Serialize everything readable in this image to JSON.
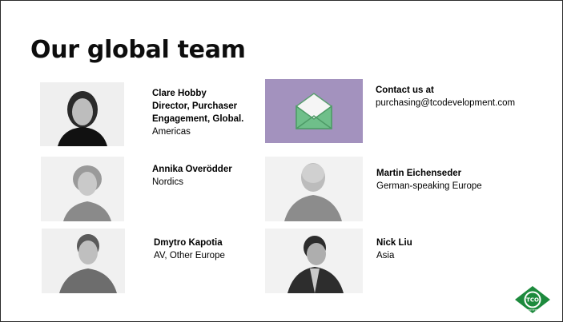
{
  "slide": {
    "title": "Our global team"
  },
  "team": [
    {
      "name": "Clare Hobby",
      "role_lines": [
        "Director, Purchaser",
        "Engagement, Global."
      ],
      "region": "Americas"
    },
    {
      "name": "Annika Overödder",
      "region": "Nordics"
    },
    {
      "name": "Dmytro Kapotia",
      "region": "AV, Other Europe"
    },
    {
      "name": "Martin Eichenseder",
      "region": "German-speaking Europe"
    },
    {
      "name": "Nick Liu",
      "region": "Asia"
    }
  ],
  "contact": {
    "label": "Contact us at",
    "email": "purchasing@tcodevelopment.com"
  },
  "logo": {
    "text": "TCO",
    "subtext": "CERTIFIED"
  },
  "colors": {
    "contact_box": "#a392be",
    "envelope_green": "#6fbf8a",
    "logo_green": "#1d8a3d"
  },
  "icons": {
    "contact": "envelope-icon"
  }
}
